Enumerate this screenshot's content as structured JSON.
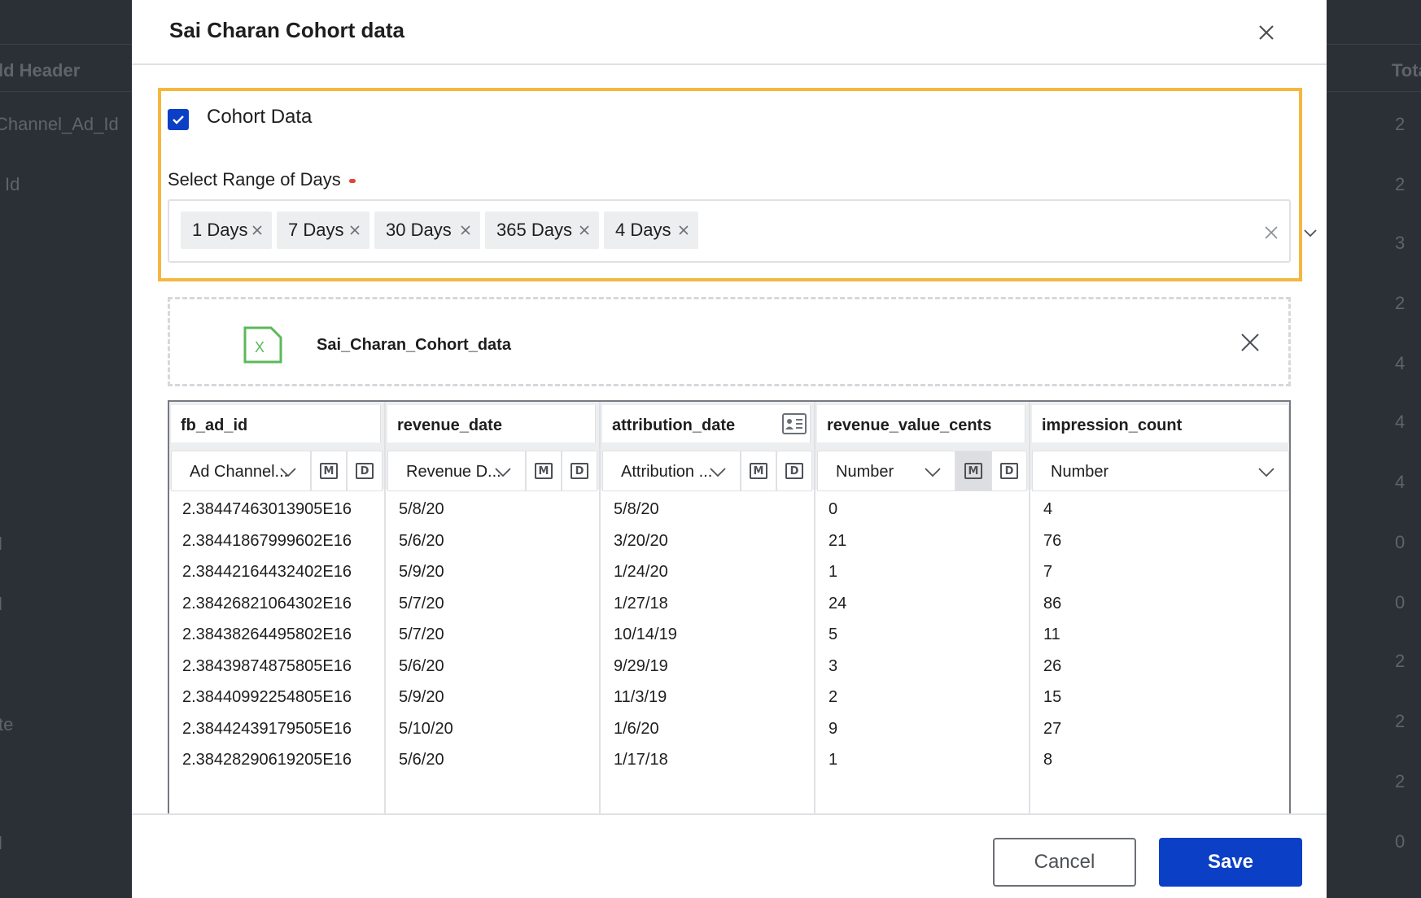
{
  "background": {
    "left_texts": [
      "ld Header",
      "Channel_Ad_Id",
      "Id",
      "l",
      "l",
      "te",
      "l"
    ],
    "right_header": "Tota",
    "right_values": [
      "2",
      "2",
      "3",
      "2",
      "4",
      "4",
      "4",
      "0",
      "0",
      "2",
      "2",
      "2",
      "0"
    ]
  },
  "modal": {
    "title": "Sai Charan Cohort data",
    "cohort_checkbox_label": "Cohort Data",
    "cohort_checked": true,
    "range_label": "Select Range of Days",
    "selected_days": [
      "1 Days",
      "7 Days",
      "30 Days",
      "365 Days",
      "4 Days"
    ],
    "file_name": "Sai_Charan_Cohort_data",
    "file_icon_letter": "X"
  },
  "table": {
    "columns": [
      {
        "name": "fb_ad_id",
        "type": "Ad Channel...",
        "has_modifiers": true
      },
      {
        "name": "revenue_date",
        "type": "Revenue D...",
        "has_modifiers": true
      },
      {
        "name": "attribution_date",
        "type": "Attribution ...",
        "has_modifiers": true
      },
      {
        "name": "revenue_value_cents",
        "type": "Number",
        "has_modifiers": true
      },
      {
        "name": "impression_count",
        "type": "Number",
        "has_modifiers": false
      }
    ],
    "modifier_labels": {
      "m": "M",
      "d": "D"
    },
    "rows": [
      [
        "2.38447463013905E16",
        "5/8/20",
        "5/8/20",
        "0",
        "4"
      ],
      [
        "2.38441867999602E16",
        "5/6/20",
        "3/20/20",
        "21",
        "76"
      ],
      [
        "2.38442164432402E16",
        "5/9/20",
        "1/24/20",
        "1",
        "7"
      ],
      [
        "2.38426821064302E16",
        "5/7/20",
        "1/27/18",
        "24",
        "86"
      ],
      [
        "2.38438264495802E16",
        "5/7/20",
        "10/14/19",
        "5",
        "11"
      ],
      [
        "2.38439874875805E16",
        "5/6/20",
        "9/29/19",
        "3",
        "26"
      ],
      [
        "2.38440992254805E16",
        "5/9/20",
        "11/3/19",
        "2",
        "15"
      ],
      [
        "2.38442439179505E16",
        "5/10/20",
        "1/6/20",
        "9",
        "27"
      ],
      [
        "2.38428290619205E16",
        "5/6/20",
        "1/17/18",
        "1",
        "8"
      ]
    ]
  },
  "footer": {
    "cancel_label": "Cancel",
    "save_label": "Save"
  },
  "colors": {
    "primary": "#0a3fc6",
    "highlight": "#f4b73f",
    "excel_green": "#5cb85c",
    "required": "#e0443d"
  }
}
